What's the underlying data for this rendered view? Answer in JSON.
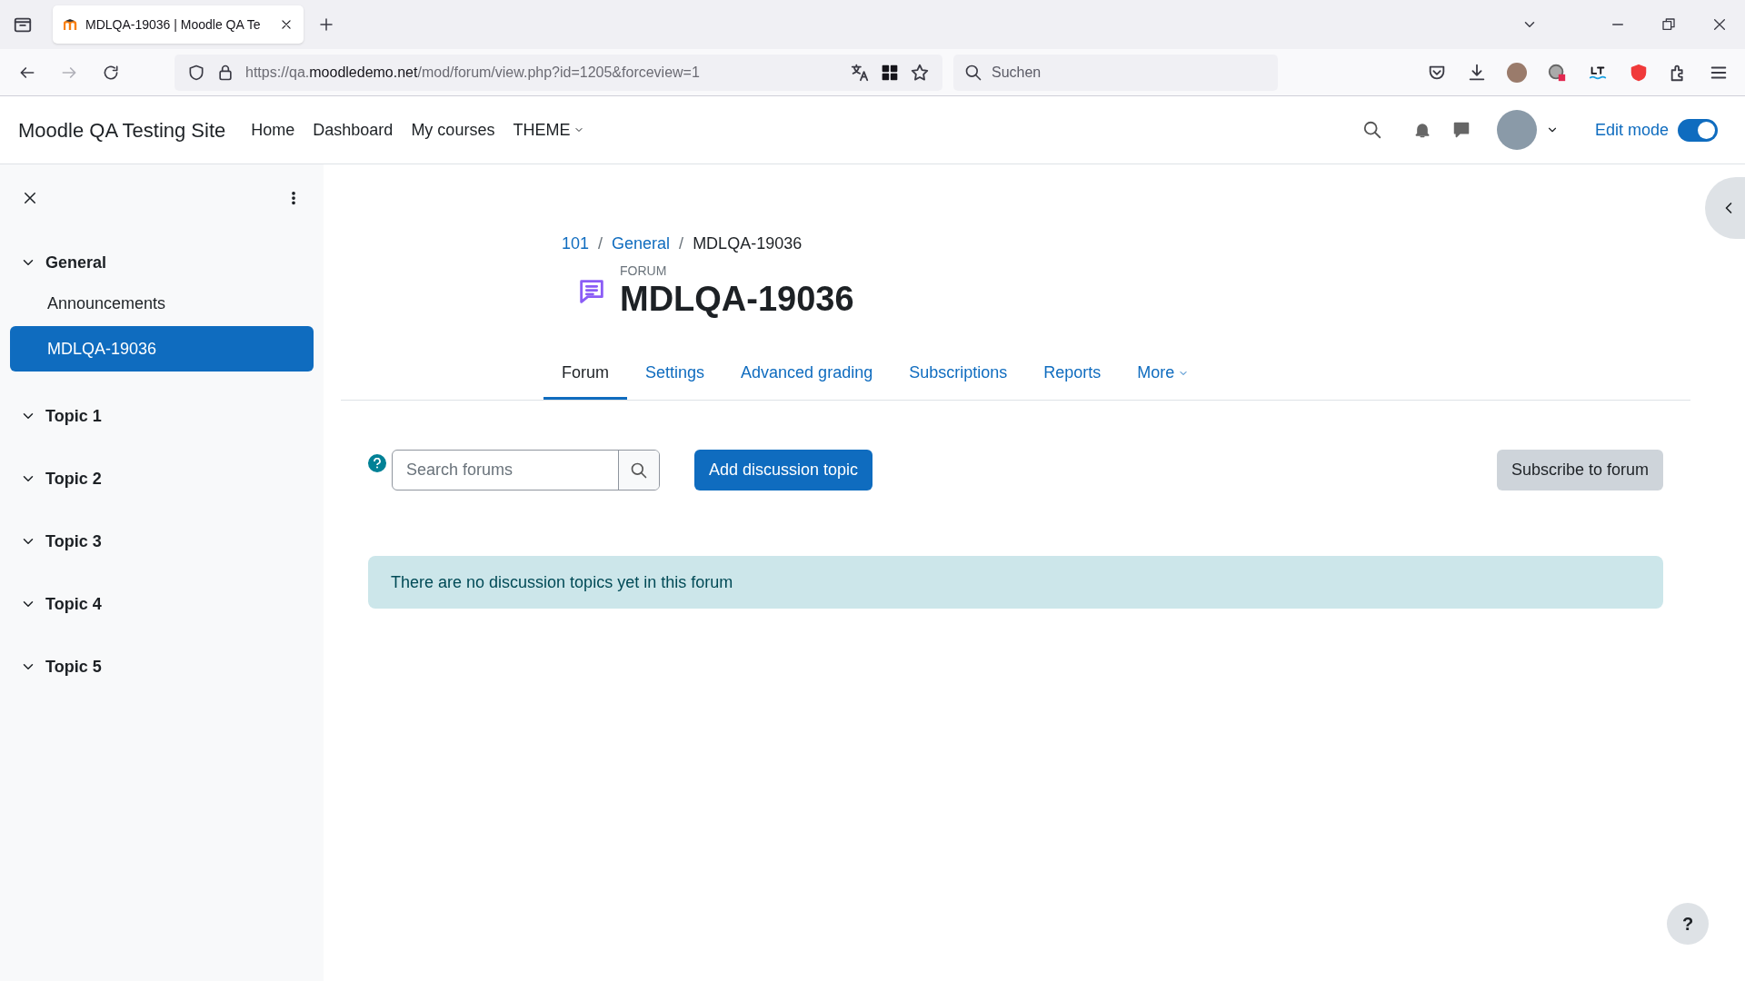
{
  "browser": {
    "tabs": [
      {
        "title": "MDLQA-19036 | Moodle QA Te",
        "selected": true
      }
    ],
    "url": {
      "scheme": "https://qa.",
      "domain": "moodledemo.net",
      "path": "/mod/forum/view.php?id=1205&forceview=1"
    },
    "search": {
      "placeholder": "Suchen"
    }
  },
  "site": {
    "title": "Moodle QA Testing Site",
    "nav": [
      {
        "label": "Home",
        "kind": "link"
      },
      {
        "label": "Dashboard",
        "kind": "link"
      },
      {
        "label": "My courses",
        "kind": "link"
      },
      {
        "label": "THEME",
        "kind": "dropdown"
      }
    ],
    "edit_mode": {
      "label": "Edit mode",
      "on": true
    }
  },
  "course_index": {
    "sections": [
      {
        "label": "General",
        "expanded": true,
        "children": [
          {
            "label": "Announcements",
            "selected": false
          },
          {
            "label": "MDLQA-19036",
            "selected": true
          }
        ]
      },
      {
        "label": "Topic 1",
        "expanded": true
      },
      {
        "label": "Topic 2",
        "expanded": true
      },
      {
        "label": "Topic 3",
        "expanded": true
      },
      {
        "label": "Topic 4",
        "expanded": true
      },
      {
        "label": "Topic 5",
        "expanded": true
      }
    ]
  },
  "breadcrumb": [
    {
      "label": "101",
      "link": true
    },
    {
      "separator": "/",
      "label": "General",
      "link": true
    },
    {
      "separator": "/",
      "label": "MDLQA-19036",
      "link": false
    }
  ],
  "header": {
    "label": "FORUM",
    "title": "MDLQA-19036"
  },
  "tabs": [
    {
      "label": "Forum",
      "selected": true,
      "kind": "link"
    },
    {
      "label": "Settings",
      "selected": false,
      "kind": "link"
    },
    {
      "label": "Advanced grading",
      "selected": false,
      "kind": "link"
    },
    {
      "label": "Subscriptions",
      "selected": false,
      "kind": "link"
    },
    {
      "label": "Reports",
      "selected": false,
      "kind": "link"
    },
    {
      "label": "More",
      "selected": false,
      "kind": "dropdown"
    }
  ],
  "toolbar": {
    "search": {
      "placeholder": "Search forums"
    },
    "add_button": "Add discussion topic",
    "subscribe_button": "Subscribe to forum"
  },
  "alert": "There are no discussion topics yet in this forum",
  "help_button": "?"
}
